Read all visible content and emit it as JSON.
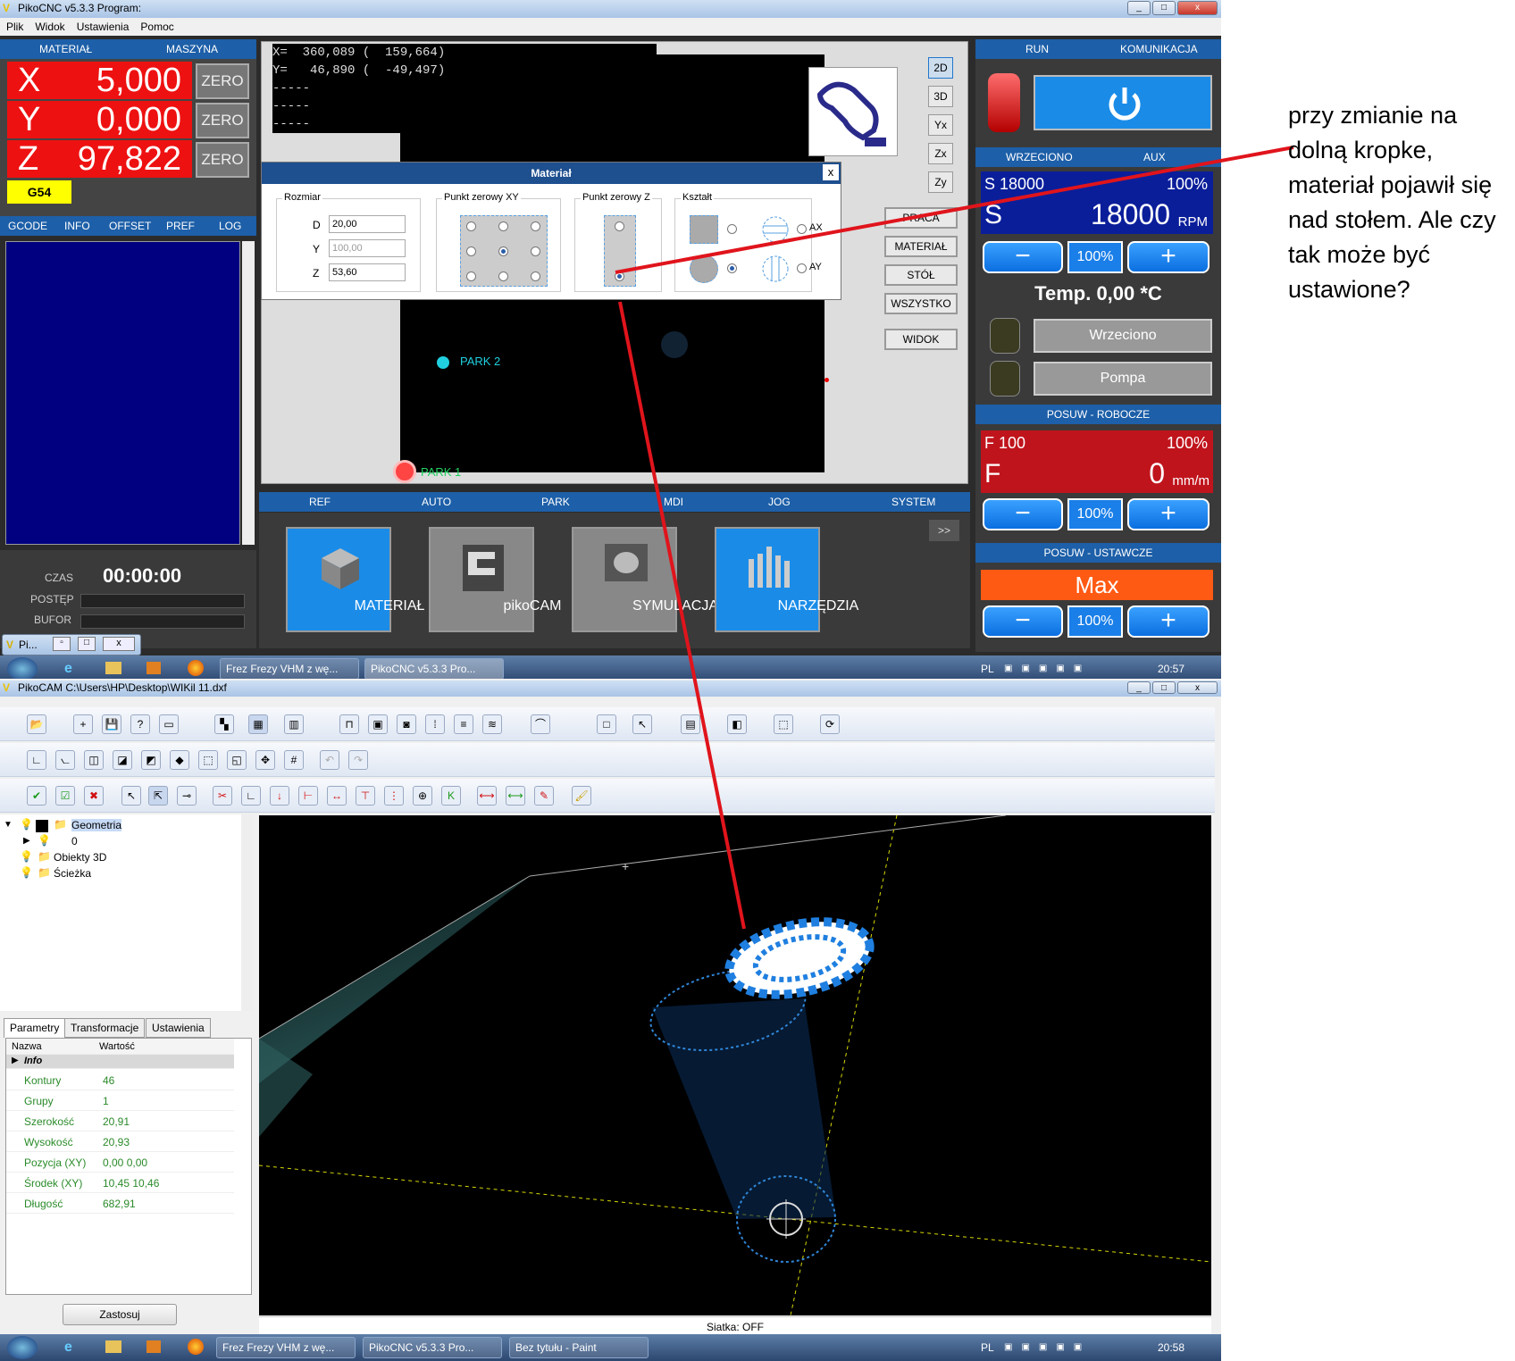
{
  "top_window": {
    "title": "PikoCNC v5.3.3   Program:",
    "menu": [
      "Plik",
      "Widok",
      "Ustawienia",
      "Pomoc"
    ],
    "dro_tabs": [
      "MATERIAŁ",
      "MASZYNA"
    ],
    "dro": [
      {
        "axis": "X",
        "value": "5,000"
      },
      {
        "axis": "Y",
        "value": "0,000"
      },
      {
        "axis": "Z",
        "value": "97,822"
      }
    ],
    "zero_label": "ZERO",
    "wcs": "G54",
    "left_tabs": [
      "GCODE",
      "INFO",
      "OFFSET",
      "PREF",
      "LOG"
    ],
    "time_label": "CZAS",
    "time_value": "00:00:00",
    "progress_label": "POSTĘP",
    "buffer_label": "BUFOR",
    "coords": [
      "X=  360,089 (  159,664)",
      "Y=   46,890 (  -49,497)",
      "-----",
      "-----",
      "-----"
    ],
    "view_buttons": [
      "2D",
      "3D",
      "Yx",
      "Zx",
      "Zy"
    ],
    "side_buttons": [
      "PRACA",
      "MATERIAŁ",
      "STÓŁ",
      "WSZYSTKO",
      "WIDOK"
    ],
    "park_labels": [
      "PARK 2",
      "PARK 1"
    ],
    "bottom_tabs": [
      "REF",
      "AUTO",
      "PARK",
      "MDI",
      "JOG",
      "SYSTEM"
    ],
    "more_button": ">>",
    "big_buttons": [
      "MATERIAŁ",
      "pikoCAM",
      "SYMULACJA",
      "NARZĘDZIA"
    ],
    "right_tabs": [
      "RUN",
      "KOMUNIKACJA"
    ],
    "spindle_tabs": [
      "WRZECIONO",
      "AUX"
    ],
    "spindle_set": "S 18000",
    "spindle_pct": "100%",
    "spindle_letter": "S",
    "spindle_rpm": "18000",
    "spindle_unit": "RPM",
    "pct_label": "100%",
    "temp": "Temp. 0,00 *C",
    "spindle_button": "Wrzeciono",
    "pump_button": "Pompa",
    "feed_title": "POSUW - ROBOCZE",
    "feed_set": "F 100",
    "feed_pct": "100%",
    "feed_letter": "F",
    "feed_value": "0",
    "feed_unit": "mm/m",
    "jog_title": "POSUW - USTAWCZE",
    "jog_value": "Max",
    "minimized_label": "Pi..."
  },
  "dialog": {
    "title": "Materiał",
    "close": "x",
    "size_group": "Rozmiar",
    "fields": [
      {
        "label": "D",
        "value": "20,00"
      },
      {
        "label": "Y",
        "value": "100,00"
      },
      {
        "label": "Z",
        "value": "53,60"
      }
    ],
    "zero_xy_group": "Punkt zerowy XY",
    "zero_z_group": "Punkt zerowy Z",
    "shape_group": "Kształt",
    "ax": "AX",
    "ay": "AY"
  },
  "taskbar1": {
    "items": [
      "Frez Frezy VHM z wę...",
      "PikoCNC v5.3.3    Pro..."
    ],
    "lang": "PL",
    "clock": "20:57"
  },
  "cam_window": {
    "title": "PikoCAM  C:\\Users\\HP\\Desktop\\WIKil  11.dxf",
    "tree": [
      "Geometria",
      "0",
      "Obiekty 3D",
      "Ścieżka"
    ],
    "tabs": [
      "Parametry",
      "Transformacje",
      "Ustawienia"
    ],
    "grid_headers": [
      "Nazwa",
      "Wartość"
    ],
    "grid_section": "Info",
    "grid_rows": [
      {
        "name": "Kontury",
        "value": "46"
      },
      {
        "name": "Grupy",
        "value": "1"
      },
      {
        "name": "Szerokość",
        "value": "20,91"
      },
      {
        "name": "Wysokość",
        "value": "20,93"
      },
      {
        "name": "Pozycja (XY)",
        "value": "0,00   0,00"
      },
      {
        "name": "Środek (XY)",
        "value": "10,45   10,46"
      },
      {
        "name": "Długość",
        "value": "682,91"
      }
    ],
    "apply": "Zastosuj",
    "status": "Siatka: OFF"
  },
  "taskbar2": {
    "items": [
      "Frez Frezy VHM z wę...",
      "PikoCNC v5.3.3    Pro...",
      "Bez tytułu - Paint"
    ],
    "lang": "PL",
    "clock": "20:58"
  },
  "annotation": "przy zmianie na dolną kropke, materiał pojawił się nad stołem. Ale czy tak może być ustawione?",
  "colors": {
    "dro_red": "#ee1111",
    "accent_blue": "#1a8ce8",
    "jog_orange": "#ff5a14",
    "feed_red": "#c0141c",
    "arrow": "#e0141c"
  }
}
